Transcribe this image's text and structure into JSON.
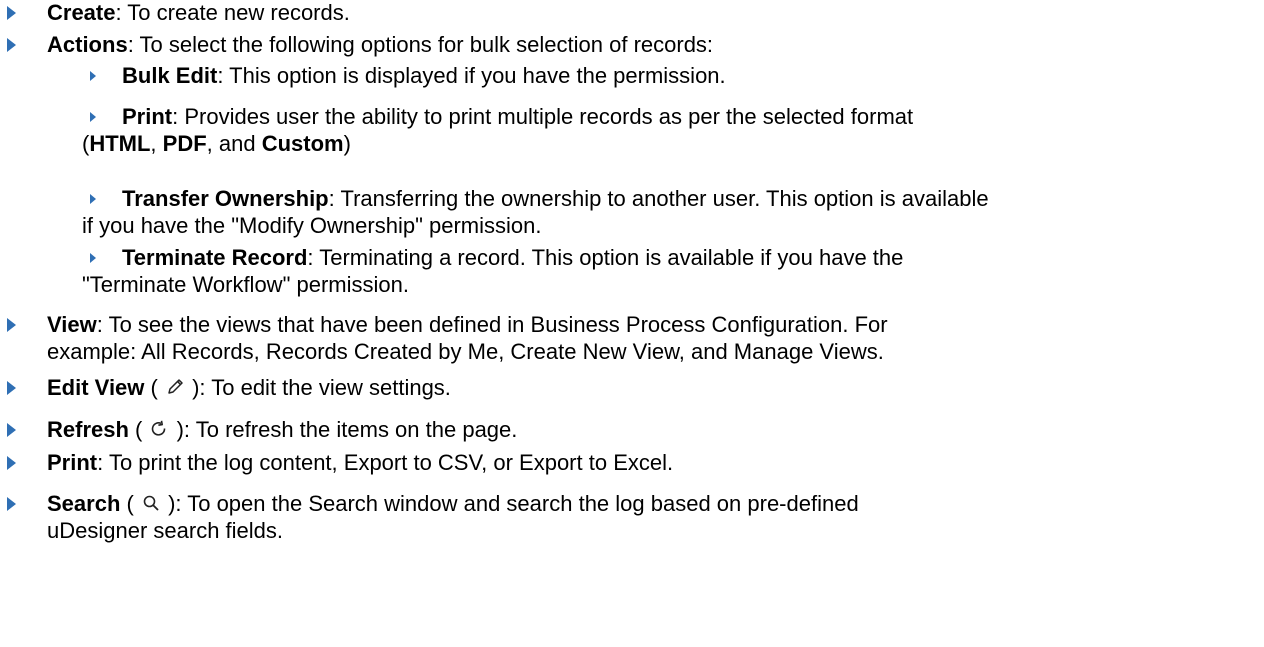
{
  "bullet_color": "#2f6fb4",
  "items": [
    {
      "term": "Create",
      "desc": ": To create new records."
    },
    {
      "term": "Actions",
      "desc": ": To select the following options for bulk selection of records:"
    },
    {
      "term": "Bulk Edit",
      "desc": ": This option is displayed if you have the permission."
    },
    {
      "term": "Print",
      "desc": ": Provides user the ability to print multiple records as per the selected format",
      "line2_open": "(",
      "fmt1": "HTML",
      "sep1": ", ",
      "fmt2": "PDF",
      "sep2": ", and ",
      "fmt3": "Custom",
      "line2_close": ")"
    },
    {
      "term": "Transfer Ownership",
      "desc": ": Transferring the ownership to another user. This option is available",
      "line2": "if you have the \"Modify Ownership\" permission."
    },
    {
      "term": "Terminate Record",
      "desc": ": Terminating a record. This option is available if you have the",
      "line2": "\"Terminate Workflow\" permission."
    },
    {
      "term": "View",
      "desc": ": To see the views that have been defined in Business Process Configuration. For",
      "line2": "example: All Records, Records Created by Me, Create New View, and Manage Views."
    },
    {
      "term": "Edit View",
      "open": " ( ",
      "icon": "pencil-icon",
      "close": " ): To edit the view settings."
    },
    {
      "term": "Refresh",
      "open": " ( ",
      "icon": "refresh-icon",
      "close": " ): To refresh the items on the page."
    },
    {
      "term": "Print",
      "desc": ": To print the log content, Export to CSV, or Export to Excel."
    },
    {
      "term": "Search",
      "open": " ( ",
      "icon": "search-icon",
      "close": " ): To open the Search window and search the log based on pre-defined",
      "line2": "uDesigner search fields."
    }
  ]
}
